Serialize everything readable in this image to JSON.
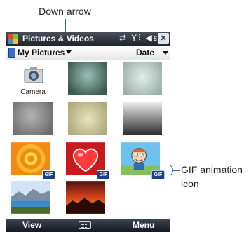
{
  "callouts": {
    "down_arrow": "Down arrow",
    "gif_icon_line1": "GIF animation",
    "gif_icon_line2": "icon"
  },
  "window": {
    "title": "Pictures & Videos",
    "status_icons": "⇄ Y⫶ ◀ε",
    "close_label": "✕"
  },
  "toolbar": {
    "folder": "My Pictures",
    "sort": "Date"
  },
  "thumbnails": [
    {
      "label": "Camera",
      "kind": "camera"
    },
    {
      "label": "",
      "kind": "photo"
    },
    {
      "label": "",
      "kind": "photo"
    },
    {
      "label": "",
      "kind": "photo"
    },
    {
      "label": "",
      "kind": "photo"
    },
    {
      "label": "",
      "kind": "photo"
    },
    {
      "label": "",
      "kind": "gif",
      "badge": "GIF"
    },
    {
      "label": "",
      "kind": "gif",
      "badge": "GIF"
    },
    {
      "label": "",
      "kind": "gif",
      "badge": "GIF"
    },
    {
      "label": "",
      "kind": "photo"
    },
    {
      "label": "",
      "kind": "photo"
    }
  ],
  "softkeys": {
    "left": "View",
    "right": "Menu"
  },
  "colors": {
    "callout": "#2c6fb0",
    "title_bar": "#2a2f38",
    "gif_badge": "#1b3f8e"
  }
}
